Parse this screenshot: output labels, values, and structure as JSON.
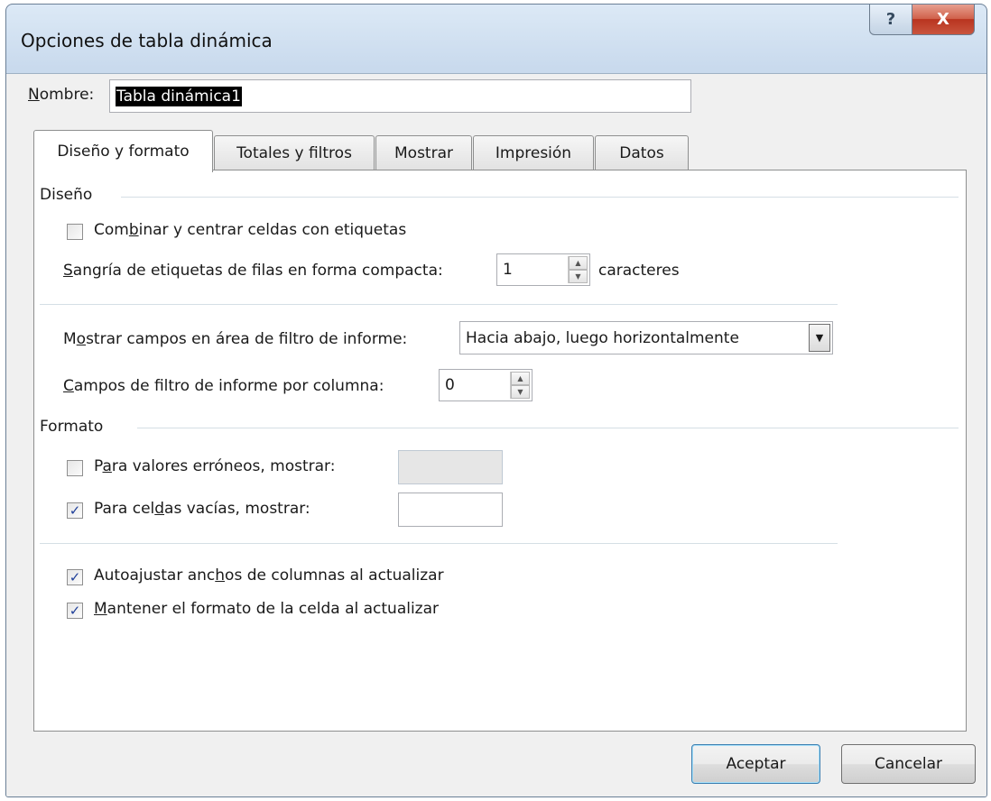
{
  "window": {
    "title": "Opciones de tabla dinámica"
  },
  "title_buttons": {
    "help_icon": "?",
    "close_icon": "X"
  },
  "name_field": {
    "label_u": "N",
    "label_rest": "ombre:",
    "value": "Tabla dinámica1"
  },
  "tabs": [
    {
      "label": "Diseño y formato",
      "active": true
    },
    {
      "label": "Totales y filtros",
      "active": false
    },
    {
      "label": "Mostrar",
      "active": false
    },
    {
      "label": "Impresión",
      "active": false
    },
    {
      "label": "Datos",
      "active": false
    }
  ],
  "layout_section": {
    "title": "Diseño",
    "merge_cells": {
      "pre": "Com",
      "u": "b",
      "post": "inar y centrar celdas con etiquetas",
      "checked": false
    },
    "indent": {
      "u": "S",
      "post": "angría de etiquetas de filas en forma compacta:",
      "value": "1",
      "unit": "caracteres"
    },
    "filter_area": {
      "pre": "M",
      "u": "o",
      "post": "strar campos en área de filtro de informe:",
      "value": "Hacia abajo, luego horizontalmente"
    },
    "filter_per_column": {
      "u": "C",
      "post": "ampos de filtro de informe por columna:",
      "value": "0"
    }
  },
  "format_section": {
    "title": "Formato",
    "error_values": {
      "pre": "P",
      "u": "a",
      "post": "ra valores erróneos, mostrar:",
      "checked": false,
      "value": ""
    },
    "empty_cells": {
      "pre": "Para cel",
      "u": "d",
      "post": "as vacías, mostrar:",
      "checked": true,
      "value": ""
    },
    "autofit": {
      "pre": "Autoajustar anc",
      "u": "h",
      "post": "os de columnas al actualizar",
      "checked": true
    },
    "preserve": {
      "u": "M",
      "post": "antener el formato de la celda al actualizar",
      "checked": true
    }
  },
  "buttons": {
    "ok": "Aceptar",
    "cancel": "Cancelar"
  },
  "glyphs": {
    "check": "✓",
    "spin_up": "▲",
    "spin_down": "▼",
    "dropdown": "▼"
  }
}
